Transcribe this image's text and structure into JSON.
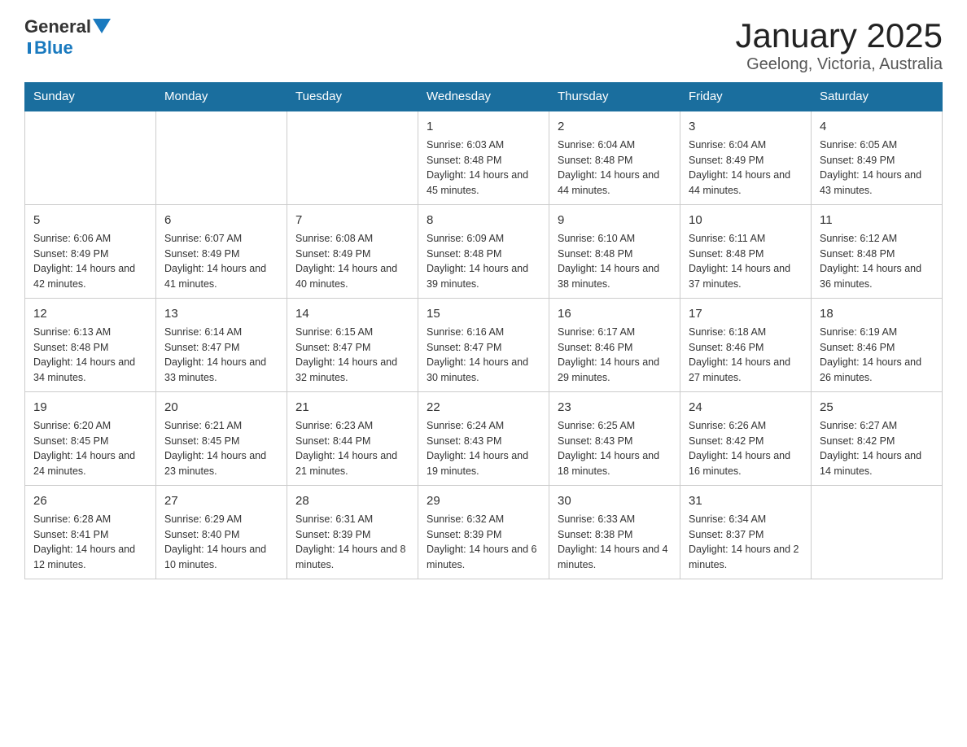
{
  "header": {
    "logo_general": "General",
    "logo_blue": "Blue",
    "title": "January 2025",
    "subtitle": "Geelong, Victoria, Australia"
  },
  "days_of_week": [
    "Sunday",
    "Monday",
    "Tuesday",
    "Wednesday",
    "Thursday",
    "Friday",
    "Saturday"
  ],
  "weeks": [
    [
      {
        "day": "",
        "info": ""
      },
      {
        "day": "",
        "info": ""
      },
      {
        "day": "",
        "info": ""
      },
      {
        "day": "1",
        "info": "Sunrise: 6:03 AM\nSunset: 8:48 PM\nDaylight: 14 hours and 45 minutes."
      },
      {
        "day": "2",
        "info": "Sunrise: 6:04 AM\nSunset: 8:48 PM\nDaylight: 14 hours and 44 minutes."
      },
      {
        "day": "3",
        "info": "Sunrise: 6:04 AM\nSunset: 8:49 PM\nDaylight: 14 hours and 44 minutes."
      },
      {
        "day": "4",
        "info": "Sunrise: 6:05 AM\nSunset: 8:49 PM\nDaylight: 14 hours and 43 minutes."
      }
    ],
    [
      {
        "day": "5",
        "info": "Sunrise: 6:06 AM\nSunset: 8:49 PM\nDaylight: 14 hours and 42 minutes."
      },
      {
        "day": "6",
        "info": "Sunrise: 6:07 AM\nSunset: 8:49 PM\nDaylight: 14 hours and 41 minutes."
      },
      {
        "day": "7",
        "info": "Sunrise: 6:08 AM\nSunset: 8:49 PM\nDaylight: 14 hours and 40 minutes."
      },
      {
        "day": "8",
        "info": "Sunrise: 6:09 AM\nSunset: 8:48 PM\nDaylight: 14 hours and 39 minutes."
      },
      {
        "day": "9",
        "info": "Sunrise: 6:10 AM\nSunset: 8:48 PM\nDaylight: 14 hours and 38 minutes."
      },
      {
        "day": "10",
        "info": "Sunrise: 6:11 AM\nSunset: 8:48 PM\nDaylight: 14 hours and 37 minutes."
      },
      {
        "day": "11",
        "info": "Sunrise: 6:12 AM\nSunset: 8:48 PM\nDaylight: 14 hours and 36 minutes."
      }
    ],
    [
      {
        "day": "12",
        "info": "Sunrise: 6:13 AM\nSunset: 8:48 PM\nDaylight: 14 hours and 34 minutes."
      },
      {
        "day": "13",
        "info": "Sunrise: 6:14 AM\nSunset: 8:47 PM\nDaylight: 14 hours and 33 minutes."
      },
      {
        "day": "14",
        "info": "Sunrise: 6:15 AM\nSunset: 8:47 PM\nDaylight: 14 hours and 32 minutes."
      },
      {
        "day": "15",
        "info": "Sunrise: 6:16 AM\nSunset: 8:47 PM\nDaylight: 14 hours and 30 minutes."
      },
      {
        "day": "16",
        "info": "Sunrise: 6:17 AM\nSunset: 8:46 PM\nDaylight: 14 hours and 29 minutes."
      },
      {
        "day": "17",
        "info": "Sunrise: 6:18 AM\nSunset: 8:46 PM\nDaylight: 14 hours and 27 minutes."
      },
      {
        "day": "18",
        "info": "Sunrise: 6:19 AM\nSunset: 8:46 PM\nDaylight: 14 hours and 26 minutes."
      }
    ],
    [
      {
        "day": "19",
        "info": "Sunrise: 6:20 AM\nSunset: 8:45 PM\nDaylight: 14 hours and 24 minutes."
      },
      {
        "day": "20",
        "info": "Sunrise: 6:21 AM\nSunset: 8:45 PM\nDaylight: 14 hours and 23 minutes."
      },
      {
        "day": "21",
        "info": "Sunrise: 6:23 AM\nSunset: 8:44 PM\nDaylight: 14 hours and 21 minutes."
      },
      {
        "day": "22",
        "info": "Sunrise: 6:24 AM\nSunset: 8:43 PM\nDaylight: 14 hours and 19 minutes."
      },
      {
        "day": "23",
        "info": "Sunrise: 6:25 AM\nSunset: 8:43 PM\nDaylight: 14 hours and 18 minutes."
      },
      {
        "day": "24",
        "info": "Sunrise: 6:26 AM\nSunset: 8:42 PM\nDaylight: 14 hours and 16 minutes."
      },
      {
        "day": "25",
        "info": "Sunrise: 6:27 AM\nSunset: 8:42 PM\nDaylight: 14 hours and 14 minutes."
      }
    ],
    [
      {
        "day": "26",
        "info": "Sunrise: 6:28 AM\nSunset: 8:41 PM\nDaylight: 14 hours and 12 minutes."
      },
      {
        "day": "27",
        "info": "Sunrise: 6:29 AM\nSunset: 8:40 PM\nDaylight: 14 hours and 10 minutes."
      },
      {
        "day": "28",
        "info": "Sunrise: 6:31 AM\nSunset: 8:39 PM\nDaylight: 14 hours and 8 minutes."
      },
      {
        "day": "29",
        "info": "Sunrise: 6:32 AM\nSunset: 8:39 PM\nDaylight: 14 hours and 6 minutes."
      },
      {
        "day": "30",
        "info": "Sunrise: 6:33 AM\nSunset: 8:38 PM\nDaylight: 14 hours and 4 minutes."
      },
      {
        "day": "31",
        "info": "Sunrise: 6:34 AM\nSunset: 8:37 PM\nDaylight: 14 hours and 2 minutes."
      },
      {
        "day": "",
        "info": ""
      }
    ]
  ]
}
